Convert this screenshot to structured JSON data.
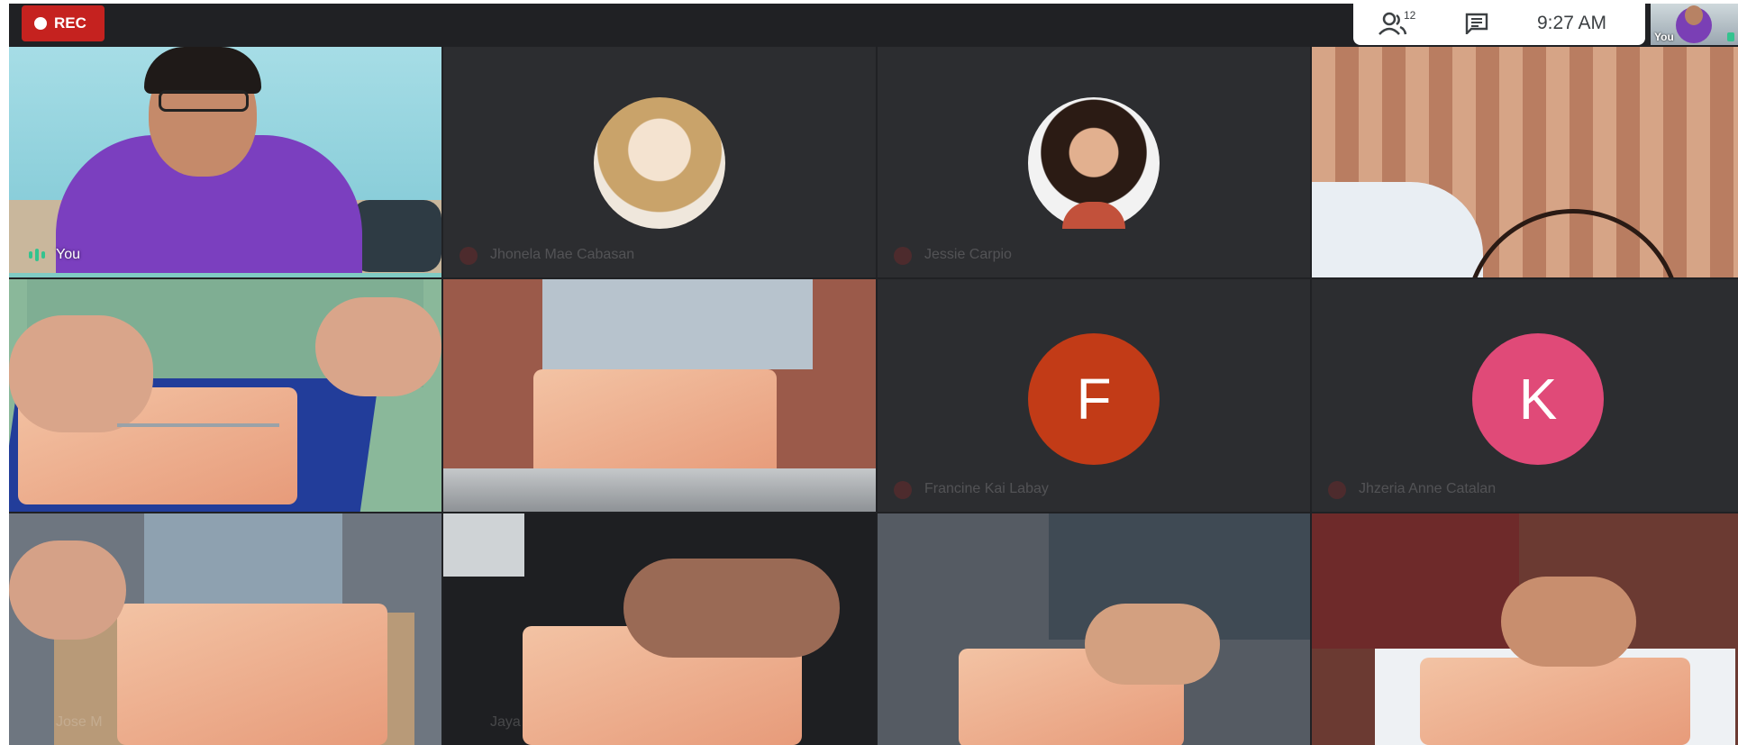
{
  "recording": {
    "label": "REC"
  },
  "topbar": {
    "participants_count": "12",
    "time": "9:27  AM",
    "icons": [
      "people-icon",
      "chat-icon"
    ]
  },
  "self_view": {
    "label": "You"
  },
  "tiles": [
    {
      "name": "You",
      "type": "video"
    },
    {
      "name": "Jhonela Mae Cabasan",
      "type": "photo"
    },
    {
      "name": "Jessie Carpio",
      "type": "photo"
    },
    {
      "name": "",
      "type": "video"
    },
    {
      "name": "",
      "type": "video"
    },
    {
      "name": "",
      "type": "video"
    },
    {
      "name": "Francine Kai Labay",
      "type": "initial",
      "initial": "F",
      "color": "#c23b17"
    },
    {
      "name": "Jhzeria Anne Catalan",
      "type": "initial",
      "initial": "K",
      "color": "#e04a78"
    },
    {
      "name": "Jose M",
      "type": "video"
    },
    {
      "name": "Jaya",
      "type": "video"
    },
    {
      "name": "",
      "type": "video"
    },
    {
      "name": "",
      "type": "video"
    }
  ],
  "colors": {
    "rec": "#c5221f",
    "active_speaker_border": "#80cbc4",
    "background": "#202124"
  }
}
